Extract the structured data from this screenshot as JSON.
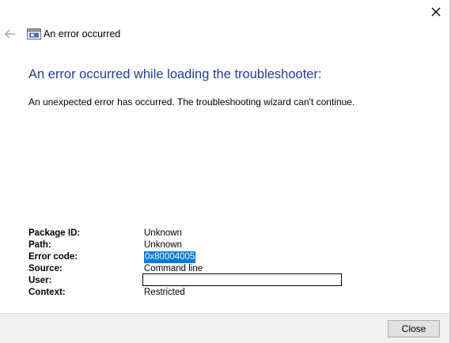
{
  "window": {
    "title": "An error occurred",
    "close_icon": "close-icon",
    "back_icon": "back-arrow-icon",
    "app_icon": "troubleshooter-icon"
  },
  "main": {
    "heading": "An error occurred while loading the troubleshooter:",
    "message": "An unexpected error has occurred. The troubleshooting wizard can't continue."
  },
  "details": [
    {
      "label": "Package ID:",
      "value": "Unknown"
    },
    {
      "label": "Path:",
      "value": "Unknown"
    },
    {
      "label": "Error code:",
      "value": "0x80004005"
    },
    {
      "label": "Source:",
      "value": "Command line"
    },
    {
      "label": "User:",
      "value": ""
    },
    {
      "label": "Context:",
      "value": "Restricted"
    }
  ],
  "footer": {
    "close_label": "Close"
  },
  "colors": {
    "heading": "#1c3f94",
    "selection": "#0078d7"
  }
}
